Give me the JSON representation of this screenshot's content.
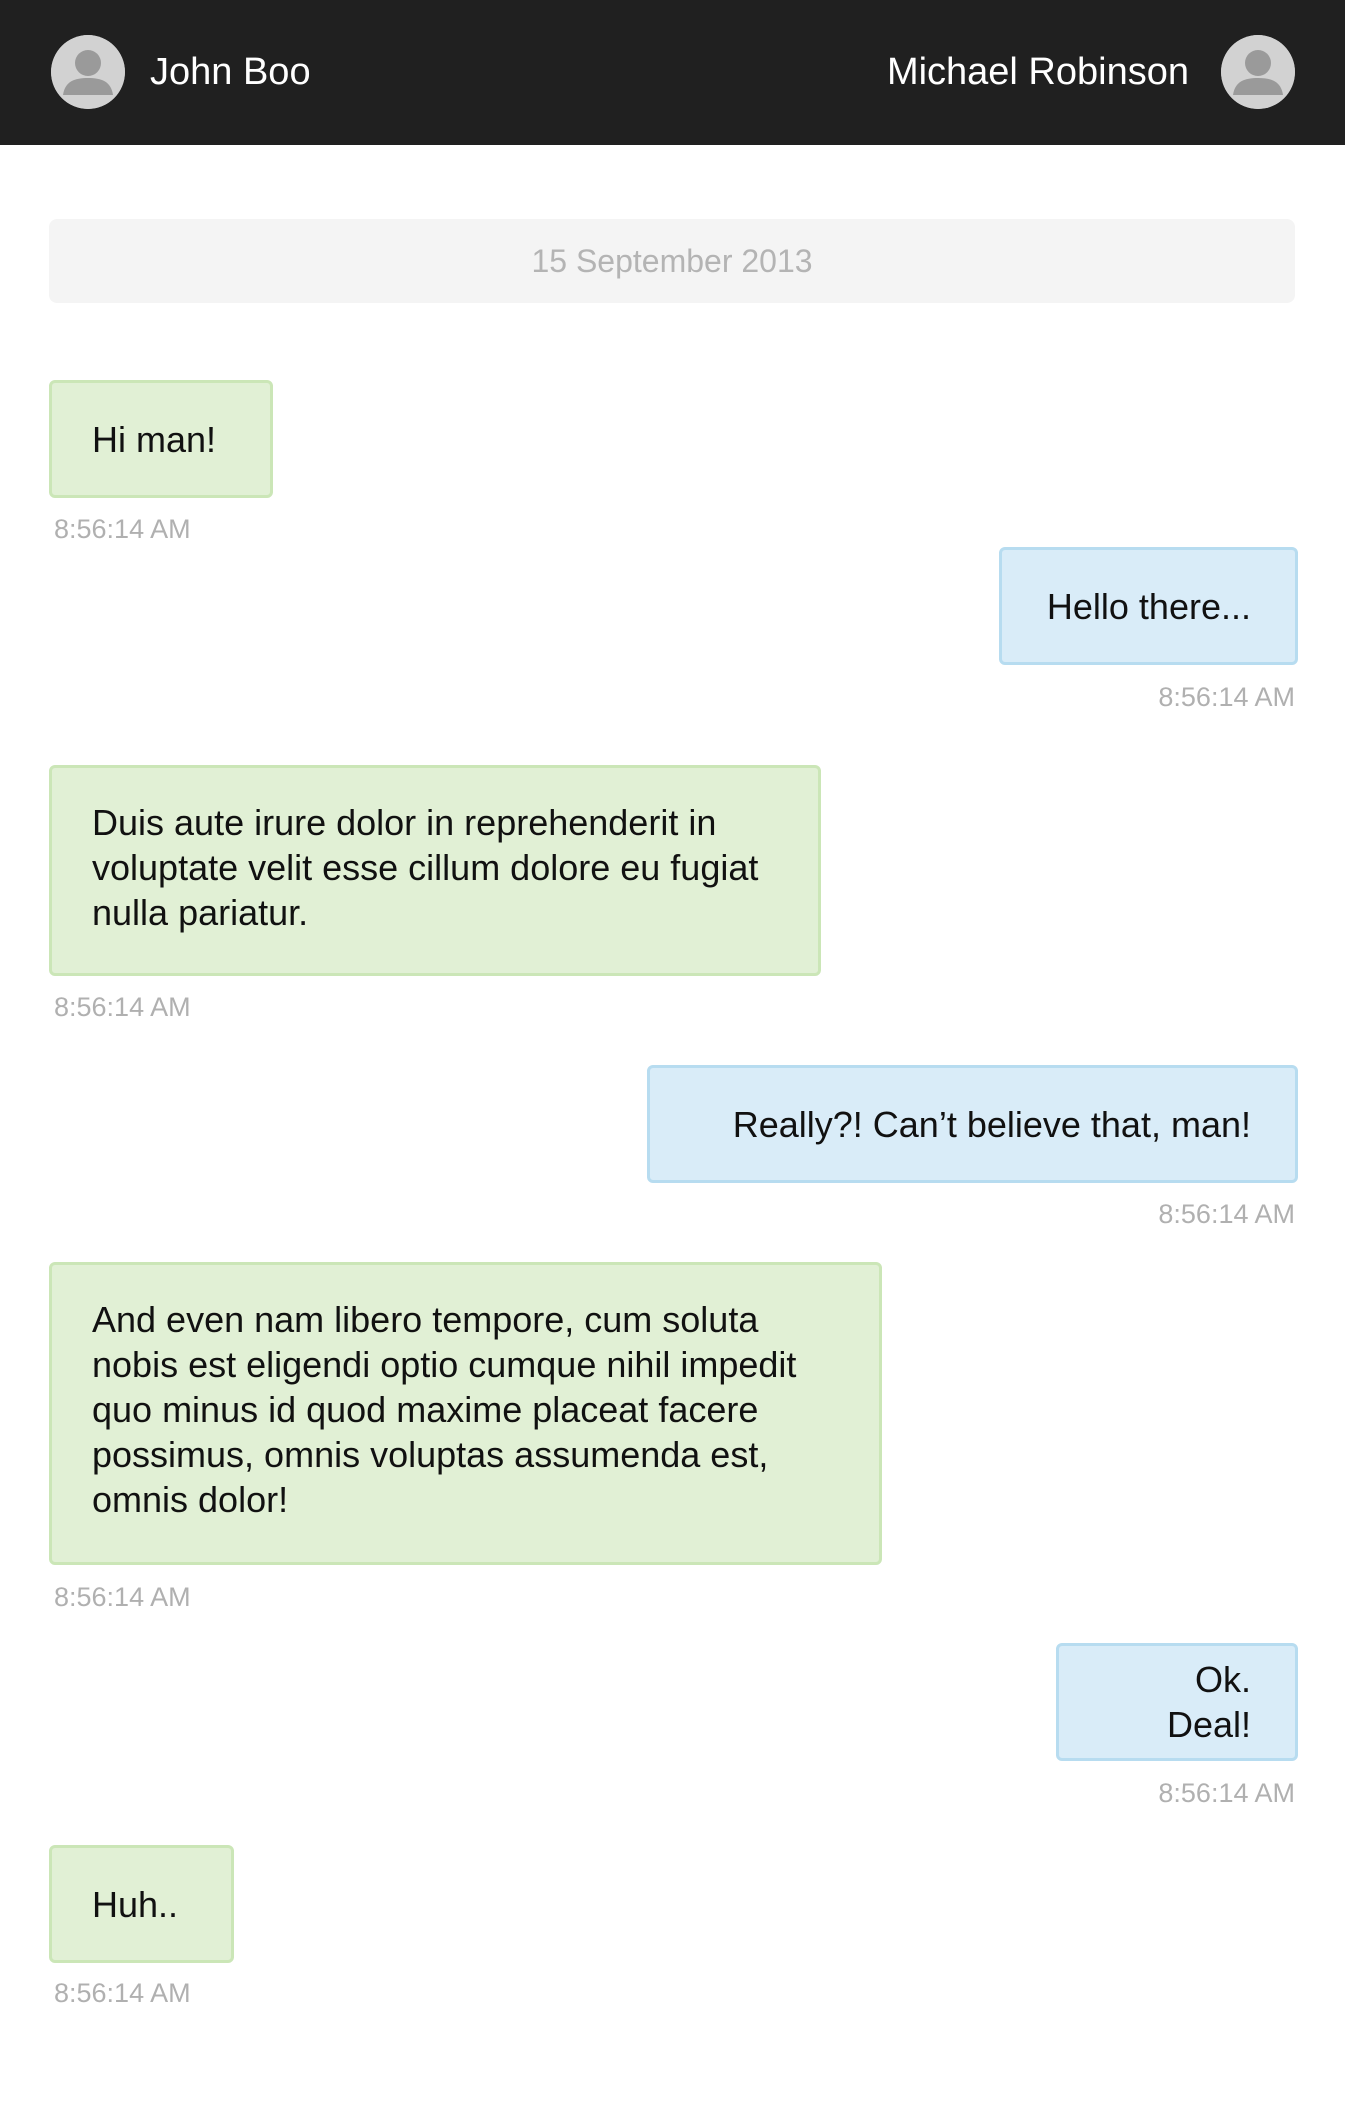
{
  "header": {
    "left_user": {
      "name": "John Boo",
      "avatar_icon": "user-silhouette-icon"
    },
    "right_user": {
      "name": "Michael Robinson",
      "avatar_icon": "user-silhouette-icon"
    },
    "background": "#202020"
  },
  "conversation": {
    "date": "15 September 2013",
    "colors": {
      "incoming_bubble": "#e1f0d5",
      "outgoing_bubble": "#d9ecf8",
      "timestamp": "#b0b0b0"
    },
    "messages": [
      {
        "side": "incoming",
        "text": "Hi man!",
        "time": "8:56:14 AM"
      },
      {
        "side": "outgoing",
        "text": "Hello there...",
        "time": "8:56:14 AM"
      },
      {
        "side": "incoming",
        "text": "Duis aute irure dolor in reprehenderit in voluptate velit esse cillum dolore eu fugiat nulla pariatur.",
        "time": "8:56:14 AM"
      },
      {
        "side": "outgoing",
        "text": "Really?! Can’t believe that, man!",
        "time": "8:56:14 AM"
      },
      {
        "side": "incoming",
        "text": "And even nam libero tempore, cum soluta nobis est eligendi optio cumque nihil impedit quo minus id quod maxime placeat facere possimus, omnis voluptas assumenda est, omnis dolor!",
        "time": "8:56:14 AM"
      },
      {
        "side": "outgoing",
        "text": "Ok. Deal!",
        "time": "8:56:14 AM"
      },
      {
        "side": "incoming",
        "text": "Huh..",
        "time": "8:56:14 AM"
      }
    ]
  }
}
